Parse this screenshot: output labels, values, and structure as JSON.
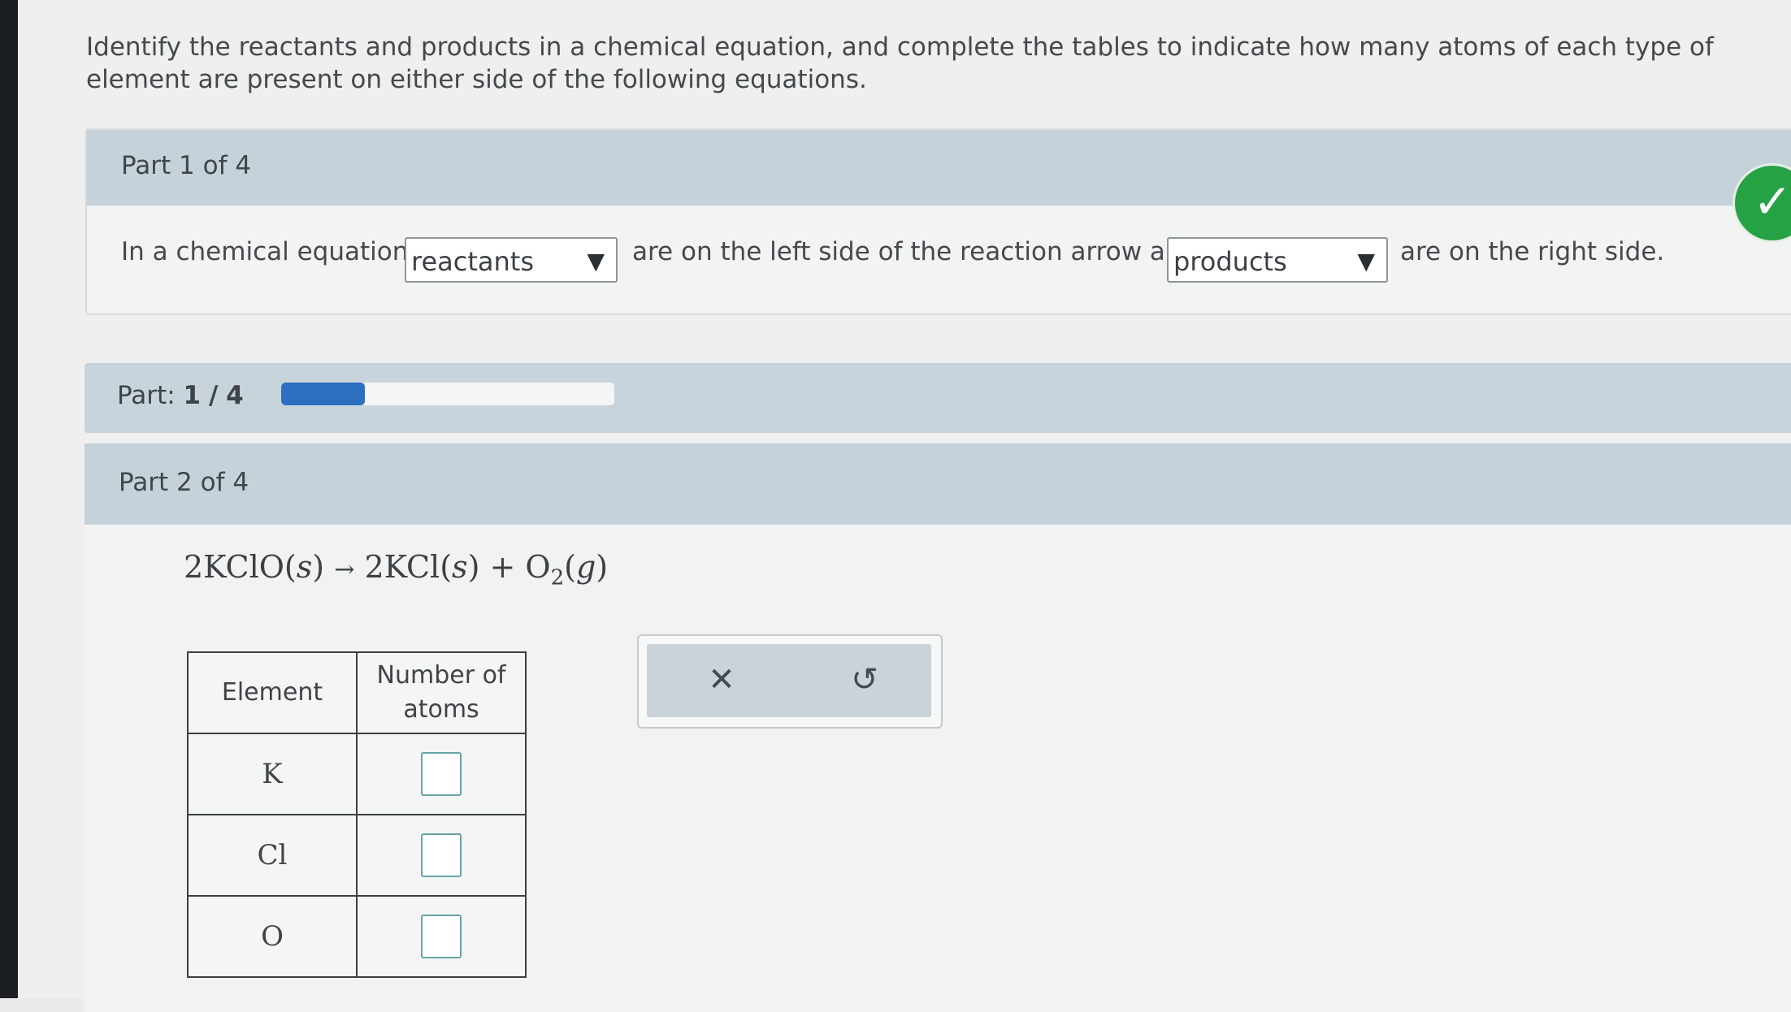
{
  "instructions": "Identify the reactants and products in a chemical equation, and complete the tables to indicate how many atoms of each type of element are present on either side of the following equations.",
  "part1": {
    "title": "Part 1 of 4",
    "sentence_start": "In a chemical equation,",
    "dropdown1_value": "reactants",
    "sentence_middle": "are on the left side of the reaction arrow and",
    "dropdown2_value": "products",
    "sentence_end": "are on the right side.",
    "status_icon": "checkmark-icon",
    "status_color": "#26a244"
  },
  "progress": {
    "label": "Part:",
    "current": "1",
    "separator": "/",
    "total": "4",
    "fraction": 0.25,
    "fill_color": "#2d6fc0"
  },
  "part2": {
    "title": "Part 2 of 4",
    "equation": {
      "reactant_coef": "2KClO(",
      "reactant_state": "s",
      "reactant_close": ")",
      "arrow": "→",
      "product1": "2KCl(",
      "product1_state": "s",
      "product1_close": ")",
      "plus": "+",
      "product2": "O",
      "product2_sub": "2",
      "product2_open": "(",
      "product2_state": "g",
      "product2_close": ")"
    },
    "table": {
      "header_element": "Element",
      "header_count_line1": "Number of",
      "header_count_line2": "atoms",
      "rows": [
        {
          "element": "K",
          "value": ""
        },
        {
          "element": "Cl",
          "value": ""
        },
        {
          "element": "O",
          "value": ""
        }
      ]
    },
    "tools": {
      "clear_symbol": "✕",
      "undo_symbol": "↺"
    }
  }
}
